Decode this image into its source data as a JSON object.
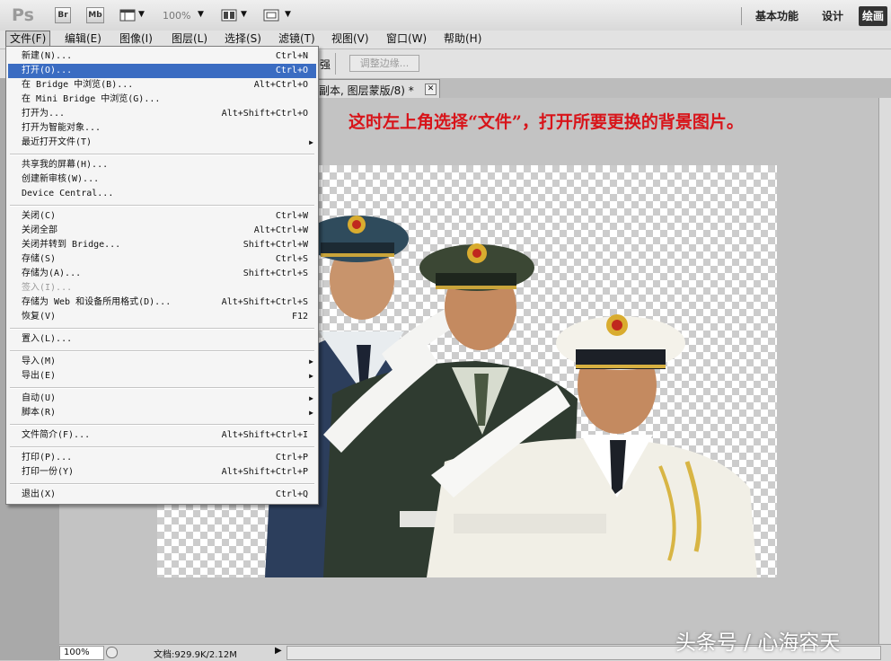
{
  "app": {
    "logo": "Ps"
  },
  "toolbar": {
    "bridge_label": "Br",
    "minibridge_label": "Mb",
    "zoom_value": "100%"
  },
  "workspaces": [
    {
      "label": "基本功能"
    },
    {
      "label": "设计"
    },
    {
      "label": "绘画"
    }
  ],
  "menubar": [
    {
      "label": "文件(F)"
    },
    {
      "label": "编辑(E)"
    },
    {
      "label": "图像(I)"
    },
    {
      "label": "图层(L)"
    },
    {
      "label": "选择(S)"
    },
    {
      "label": "滤镜(T)"
    },
    {
      "label": "视图(V)"
    },
    {
      "label": "窗口(W)"
    },
    {
      "label": "帮助(H)"
    }
  ],
  "options": {
    "enhance_label": "强",
    "refine_edge_label": "调整边缘..."
  },
  "document_tab": {
    "title": "副本, 图层蒙版/8) *"
  },
  "file_menu": {
    "items": [
      {
        "label": "新建(N)...",
        "shortcut": "Ctrl+N"
      },
      {
        "label": "打开(O)...",
        "shortcut": "Ctrl+O",
        "highlighted": true
      },
      {
        "label": "在 Bridge 中浏览(B)...",
        "shortcut": "Alt+Ctrl+O"
      },
      {
        "label": "在 Mini Bridge 中浏览(G)...",
        "shortcut": ""
      },
      {
        "label": "打开为...",
        "shortcut": "Alt+Shift+Ctrl+O"
      },
      {
        "label": "打开为智能对象...",
        "shortcut": ""
      },
      {
        "label": "最近打开文件(T)",
        "shortcut": "",
        "submenu": true
      },
      {
        "label": "共享我的屏幕(H)...",
        "shortcut": ""
      },
      {
        "label": "创建新审核(W)...",
        "shortcut": ""
      },
      {
        "label": "Device Central...",
        "shortcut": ""
      },
      {
        "label": "关闭(C)",
        "shortcut": "Ctrl+W"
      },
      {
        "label": "关闭全部",
        "shortcut": "Alt+Ctrl+W"
      },
      {
        "label": "关闭并转到 Bridge...",
        "shortcut": "Shift+Ctrl+W"
      },
      {
        "label": "存储(S)",
        "shortcut": "Ctrl+S"
      },
      {
        "label": "存储为(A)...",
        "shortcut": "Shift+Ctrl+S"
      },
      {
        "label": "签入(I)...",
        "shortcut": "",
        "disabled": true
      },
      {
        "label": "存储为 Web 和设备所用格式(D)...",
        "shortcut": "Alt+Shift+Ctrl+S"
      },
      {
        "label": "恢复(V)",
        "shortcut": "F12"
      },
      {
        "label": "置入(L)...",
        "shortcut": ""
      },
      {
        "label": "导入(M)",
        "shortcut": "",
        "submenu": true
      },
      {
        "label": "导出(E)",
        "shortcut": "",
        "submenu": true
      },
      {
        "label": "自动(U)",
        "shortcut": "",
        "submenu": true
      },
      {
        "label": "脚本(R)",
        "shortcut": "",
        "submenu": true
      },
      {
        "label": "文件简介(F)...",
        "shortcut": "Alt+Shift+Ctrl+I"
      },
      {
        "label": "打印(P)...",
        "shortcut": "Ctrl+P"
      },
      {
        "label": "打印一份(Y)",
        "shortcut": "Alt+Shift+Ctrl+P"
      },
      {
        "label": "退出(X)",
        "shortcut": "Ctrl+Q"
      }
    ]
  },
  "annotation": "这时左上角选择“文件”，打开所要更换的背景图片。",
  "status": {
    "zoom": "100%",
    "doc_size": "文档:929.9K/2.12M"
  },
  "watermark": "头条号 / 心海容天",
  "colors": {
    "highlight": "#3a6cc2",
    "annotation": "#d8141a"
  }
}
